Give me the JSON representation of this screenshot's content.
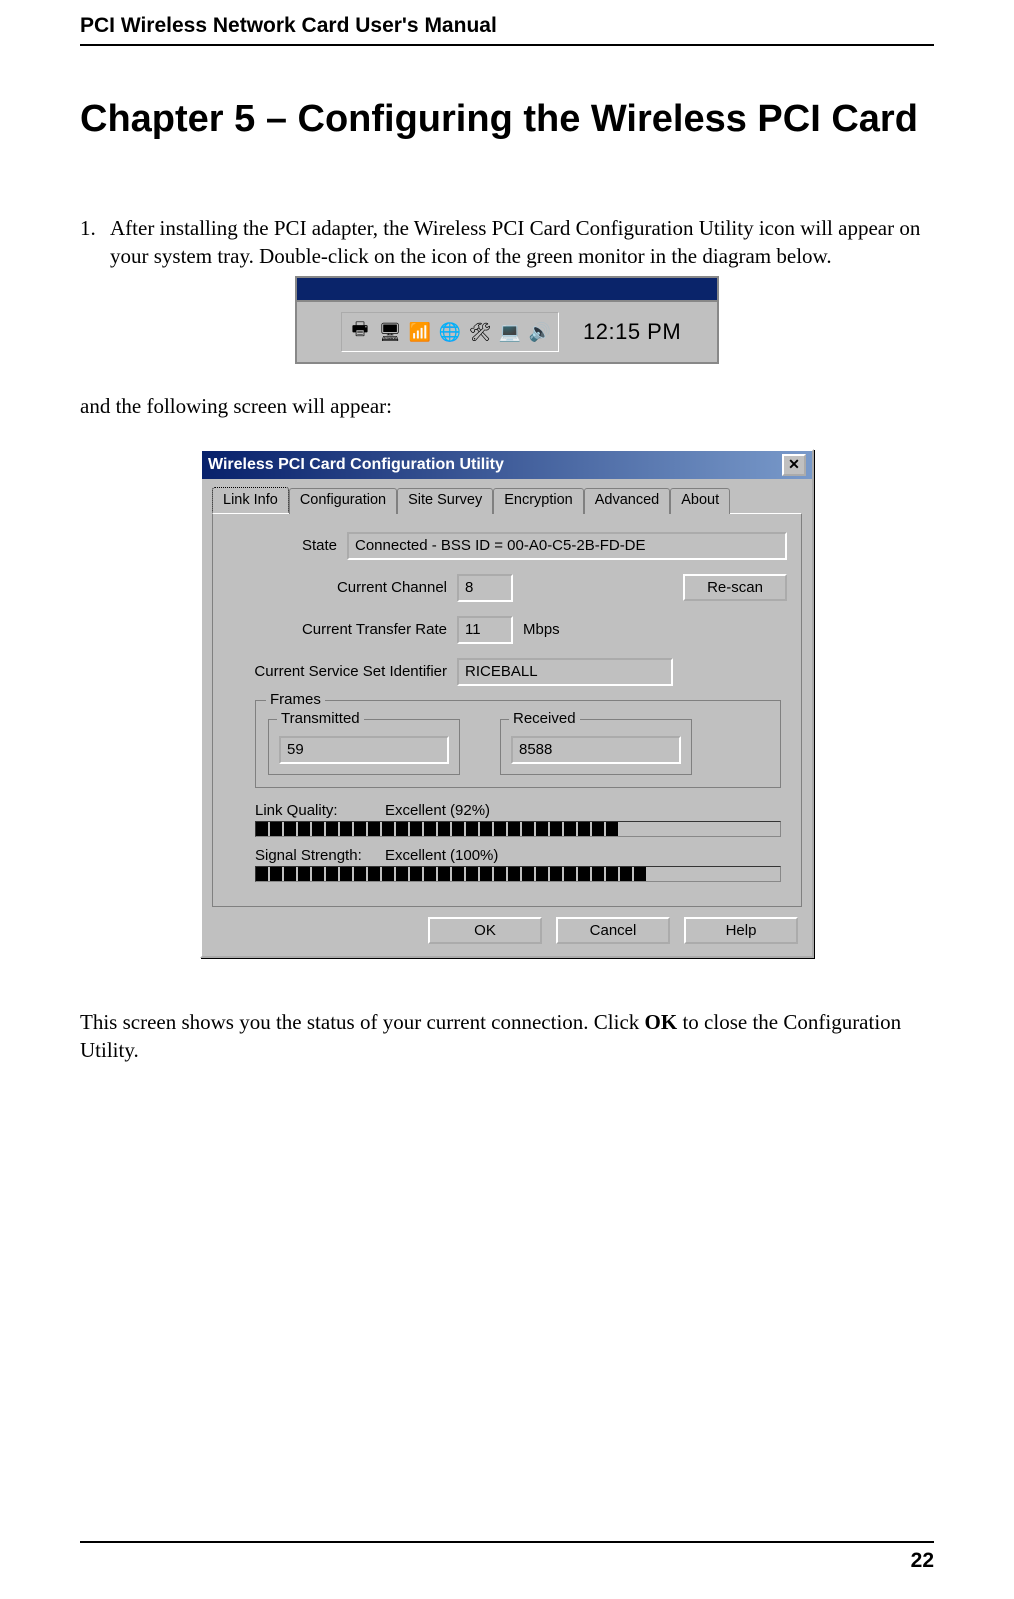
{
  "doc": {
    "header": "PCI Wireless Network Card User's Manual",
    "page_number": "22",
    "chapter_title": "Chapter 5 – Configuring the Wireless PCI Card",
    "step_number": "1.",
    "step_text": "After installing the PCI adapter, the Wireless PCI Card Configuration Utility icon will appear on your system tray. Double-click on the icon of the green monitor in the diagram below.",
    "after_tray_text": "and the following screen will appear:",
    "closing_text_pre": "This screen shows you the status of your current connection. Click ",
    "closing_text_bold": "OK",
    "closing_text_post": " to close the Configuration Utility."
  },
  "tray": {
    "clock": "12:15 PM",
    "icons": [
      "printer-icon",
      "monitor-icon",
      "signal-icon",
      "globe-icon",
      "tool-icon",
      "display-icon",
      "sound-icon"
    ]
  },
  "dialog": {
    "title": "Wireless PCI Card Configuration Utility",
    "tabs": [
      "Link Info",
      "Configuration",
      "Site Survey",
      "Encryption",
      "Advanced",
      "About"
    ],
    "active_tab_index": 0,
    "state_label": "State",
    "state_value": "Connected - BSS ID = 00-A0-C5-2B-FD-DE",
    "channel_label": "Current Channel",
    "channel_value": "8",
    "rescan_button": "Re-scan",
    "rate_label": "Current Transfer Rate",
    "rate_value": "11",
    "rate_unit": "Mbps",
    "ssid_label": "Current Service Set Identifier",
    "ssid_value": "RICEBALL",
    "frames_label": "Frames",
    "transmitted_label": "Transmitted",
    "transmitted_value": "59",
    "received_label": "Received",
    "received_value": "8588",
    "link_quality_label": "Link Quality:",
    "link_quality_value": "Excellent (92%)",
    "link_quality_segments": 26,
    "signal_strength_label": "Signal Strength:",
    "signal_strength_value": "Excellent (100%)",
    "signal_strength_segments": 28,
    "ok_button": "OK",
    "cancel_button": "Cancel",
    "help_button": "Help"
  }
}
